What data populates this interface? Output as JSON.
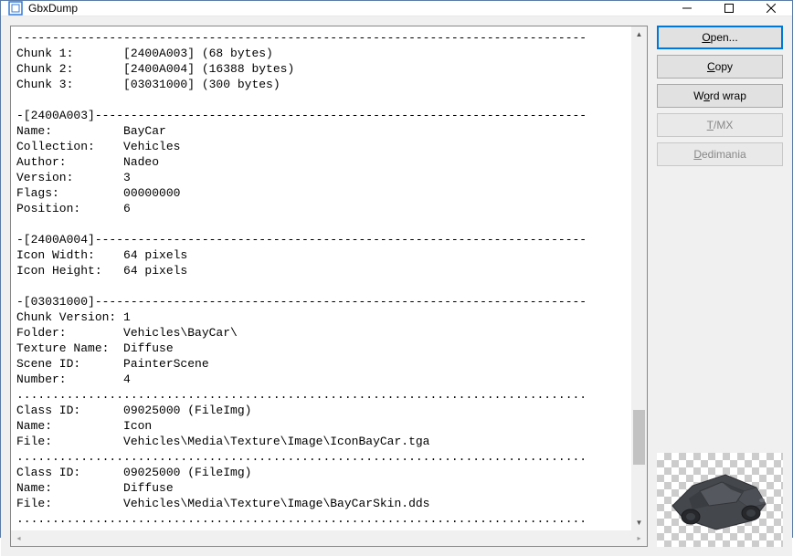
{
  "window": {
    "title": "GbxDump"
  },
  "buttons": {
    "open": "Open...",
    "copy": "Copy",
    "wordwrap_pre": "W",
    "wordwrap_post": "ord wrap",
    "tmx": "T/MX",
    "dedimania": "Dedimania"
  },
  "dump_lines": [
    "--------------------------------------------------------------------------------",
    "Chunk 1:       [2400A003] (68 bytes)",
    "Chunk 2:       [2400A004] (16388 bytes)",
    "Chunk 3:       [03031000] (300 bytes)",
    "",
    "-[2400A003]---------------------------------------------------------------------",
    "Name:          BayCar",
    "Collection:    Vehicles",
    "Author:        Nadeo",
    "Version:       3",
    "Flags:         00000000",
    "Position:      6",
    "",
    "-[2400A004]---------------------------------------------------------------------",
    "Icon Width:    64 pixels",
    "Icon Height:   64 pixels",
    "",
    "-[03031000]---------------------------------------------------------------------",
    "Chunk Version: 1",
    "Folder:        Vehicles\\BayCar\\",
    "Texture Name:  Diffuse",
    "Scene ID:      PainterScene",
    "Number:        4",
    "................................................................................",
    "Class ID:      09025000 (FileImg)",
    "Name:          Icon",
    "File:          Vehicles\\Media\\Texture\\Image\\IconBayCar.tga",
    "................................................................................",
    "Class ID:      09025000 (FileImg)",
    "Name:          Diffuse",
    "File:          Vehicles\\Media\\Texture\\Image\\BayCarSkin.dds",
    "................................................................................"
  ]
}
